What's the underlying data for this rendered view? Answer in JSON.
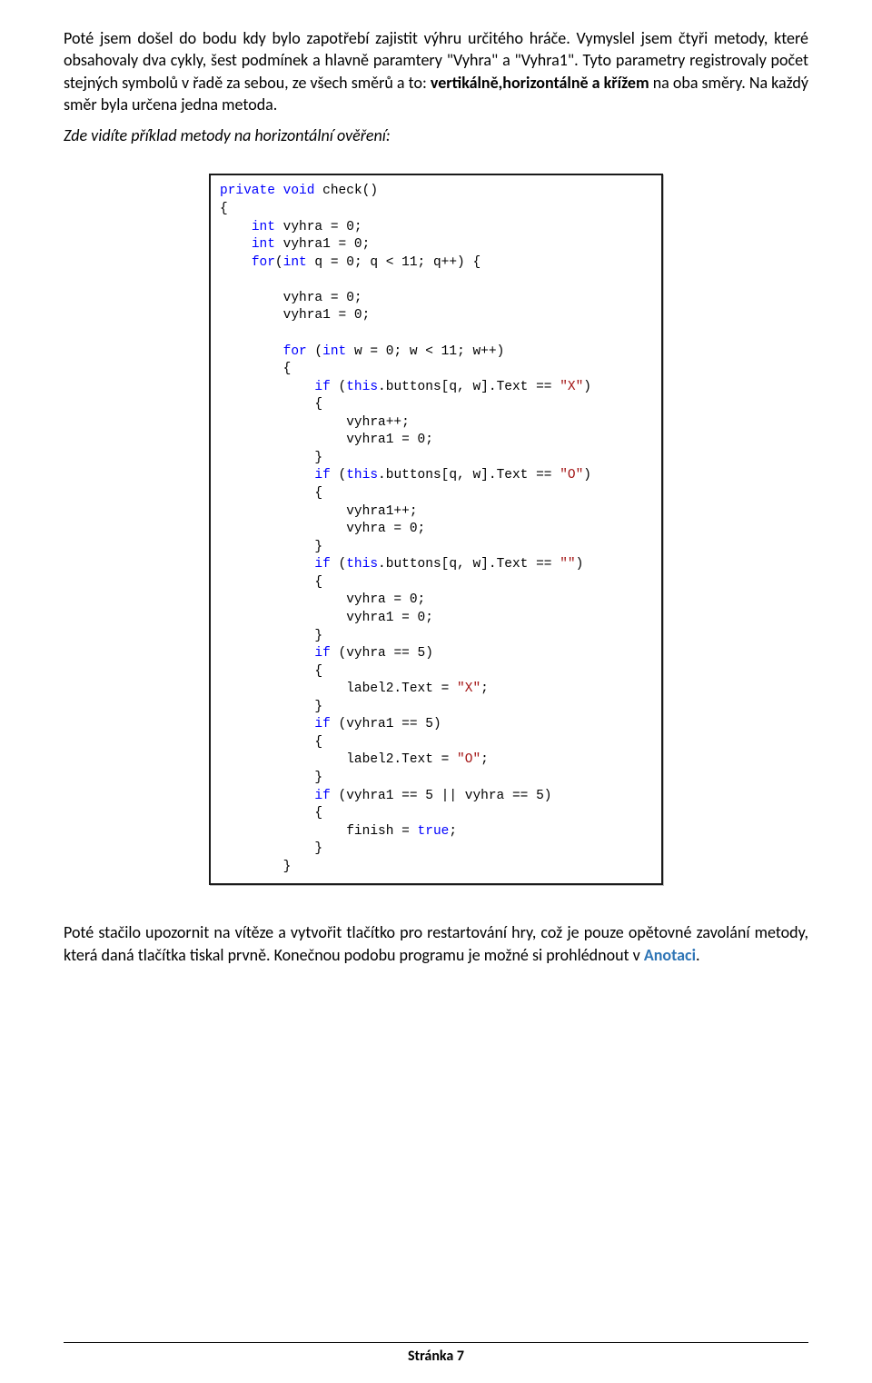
{
  "para1_pre": "Poté jsem došel do bodu kdy bylo zapotřebí zajistit výhru určitého hráče. Vymyslel jsem čtyři metody, které obsahovaly dva cykly, šest podmínek a hlavně paramtery \"Vyhra\" a \"Vyhra1\". Tyto parametry registrovaly počet stejných symbolů v řadě za sebou, ze všech směrů a to: ",
  "para1_bold": "vertikálně,horizontálně a křížem",
  "para1_post": " na oba směry. Na každý směr byla určena jedna metoda.",
  "para2": "Zde vidíte příklad metody na horizontální ověření:",
  "para3_pre": "Poté stačilo upozornit na vítěze a vytvořit tlačítko pro restartování hry, což je pouze opětovné zavolání metody, která daná tlačítka tiskal prvně. Konečnou podobu programu je možné si prohlédnout v ",
  "para3_link": "Anotaci",
  "para3_post": ".",
  "footer": "Stránka 7",
  "code": {
    "l01a": "private",
    "l01b": " ",
    "l01c": "void",
    "l01d": " check()",
    "l02": "{",
    "l03a": "    ",
    "l03b": "int",
    "l03c": " vyhra = 0;",
    "l04a": "    ",
    "l04b": "int",
    "l04c": " vyhra1 = 0;",
    "l05a": "    ",
    "l05b": "for",
    "l05c": "(",
    "l05d": "int",
    "l05e": " q = 0; q < 11; q++) {",
    "l06": "",
    "l07": "        vyhra = 0;",
    "l08": "        vyhra1 = 0;",
    "l09": "",
    "l10a": "        ",
    "l10b": "for",
    "l10c": " (",
    "l10d": "int",
    "l10e": " w = 0; w < 11; w++)",
    "l11": "        {",
    "l12a": "            ",
    "l12b": "if",
    "l12c": " (",
    "l12d": "this",
    "l12e": ".buttons[q, w].Text == ",
    "l12f": "\"X\"",
    "l12g": ")",
    "l13": "            {",
    "l14": "                vyhra++;",
    "l15": "                vyhra1 = 0;",
    "l16": "            }",
    "l17a": "            ",
    "l17b": "if",
    "l17c": " (",
    "l17d": "this",
    "l17e": ".buttons[q, w].Text == ",
    "l17f": "\"O\"",
    "l17g": ")",
    "l18": "            {",
    "l19": "                vyhra1++;",
    "l20": "                vyhra = 0;",
    "l21": "            }",
    "l22a": "            ",
    "l22b": "if",
    "l22c": " (",
    "l22d": "this",
    "l22e": ".buttons[q, w].Text == ",
    "l22f": "\"\"",
    "l22g": ")",
    "l23": "            {",
    "l24": "                vyhra = 0;",
    "l25": "                vyhra1 = 0;",
    "l26": "            }",
    "l27a": "            ",
    "l27b": "if",
    "l27c": " (vyhra == 5)",
    "l28": "            {",
    "l29a": "                label2.Text = ",
    "l29b": "\"X\"",
    "l29c": ";",
    "l30": "            }",
    "l31a": "            ",
    "l31b": "if",
    "l31c": " (vyhra1 == 5)",
    "l32": "            {",
    "l33a": "                label2.Text = ",
    "l33b": "\"O\"",
    "l33c": ";",
    "l34": "            }",
    "l35a": "            ",
    "l35b": "if",
    "l35c": " (vyhra1 == 5 || vyhra == 5)",
    "l36": "            {",
    "l37a": "                finish = ",
    "l37b": "true",
    "l37c": ";",
    "l38": "            }",
    "l39": "        }"
  }
}
